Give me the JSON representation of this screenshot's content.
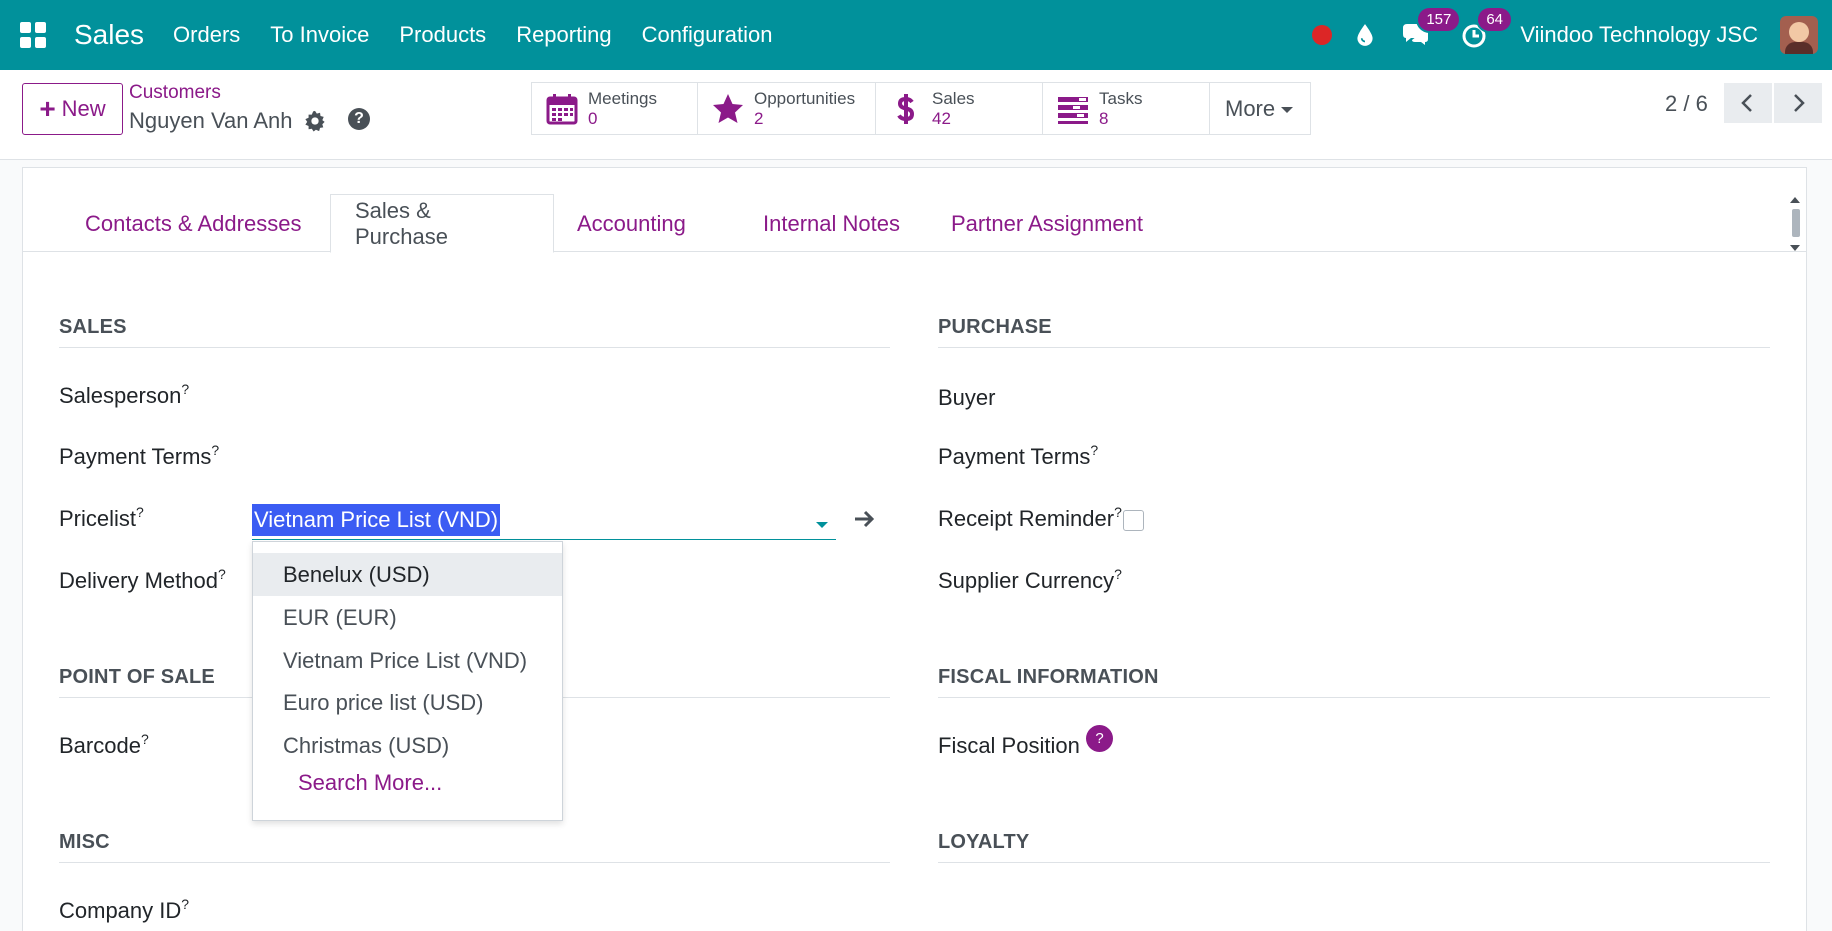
{
  "navbar": {
    "app_name": "Sales",
    "menu": [
      "Orders",
      "To Invoice",
      "Products",
      "Reporting",
      "Configuration"
    ],
    "messages_count": "157",
    "activities_count": "64",
    "company": "Viindoo Technology JSC",
    "icons": [
      "apps-grid-icon",
      "record-dot-icon",
      "drop-icon",
      "chat-icon",
      "clock-icon",
      "avatar"
    ]
  },
  "control": {
    "new_label": "New",
    "breadcrumb_parent": "Customers",
    "breadcrumb_current": "Nguyen Van Anh",
    "smart_buttons": [
      {
        "label": "Meetings",
        "value": "0",
        "icon": "calendar-icon"
      },
      {
        "label": "Opportunities",
        "value": "2",
        "icon": "star-icon"
      },
      {
        "label": "Sales",
        "value": "42",
        "icon": "dollar-icon"
      },
      {
        "label": "Tasks",
        "value": "8",
        "icon": "tasks-icon"
      }
    ],
    "more_label": "More",
    "pager": "2 / 6"
  },
  "tabs": [
    "Contacts & Addresses",
    "Sales & Purchase",
    "Accounting",
    "Internal Notes",
    "Partner Assignment"
  ],
  "active_tab": "Sales & Purchase",
  "sales": {
    "title": "SALES",
    "salesperson": "Salesperson",
    "payment_terms": "Payment Terms",
    "pricelist": "Pricelist",
    "pricelist_value": "Vietnam Price List (VND)",
    "delivery_method": "Delivery Method"
  },
  "purchase": {
    "title": "PURCHASE",
    "buyer": "Buyer",
    "payment_terms": "Payment Terms",
    "receipt_reminder": "Receipt Reminder",
    "supplier_currency": "Supplier Currency"
  },
  "pos": {
    "title": "POINT OF SALE",
    "barcode": "Barcode"
  },
  "fiscal": {
    "title": "FISCAL INFORMATION",
    "fiscal_position": "Fiscal Position",
    "help": "?"
  },
  "misc": {
    "title": "MISC",
    "company_id": "Company ID"
  },
  "loyalty": {
    "title": "LOYALTY"
  },
  "dropdown": {
    "options": [
      "Benelux (USD)",
      "EUR (EUR)",
      "Vietnam Price List (VND)",
      "Euro price list (USD)",
      "Christmas (USD)"
    ],
    "highlighted": "Benelux (USD)",
    "search_more": "Search More..."
  },
  "colors": {
    "navbar": "#01919b",
    "accent": "#8b1a89",
    "selection": "#3b5cf3"
  }
}
